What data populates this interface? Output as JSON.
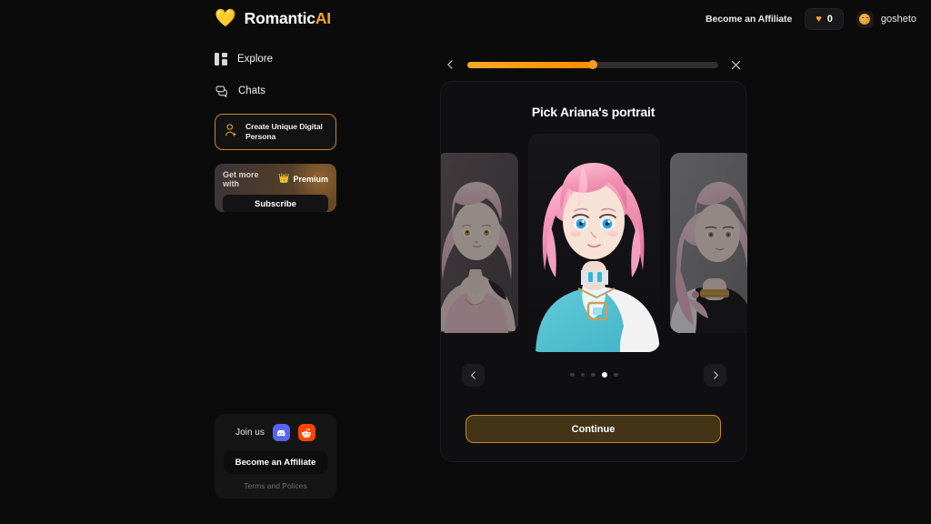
{
  "brand": {
    "heart": "💛",
    "name": "Romantic",
    "suffix": "AI"
  },
  "header": {
    "affiliate_label": "Become an Affiliate",
    "token_icon": "heart-icon",
    "token_count": "0",
    "user_name": "gosheto",
    "avatar_icon": "user-avatar-icon"
  },
  "sidebar": {
    "items": [
      {
        "label": "Explore",
        "icon": "grid-icon"
      },
      {
        "label": "Chats",
        "icon": "chat-bubble-icon"
      }
    ],
    "create_persona": {
      "label": "Create Unique Digital Persona",
      "icon": "add-user-icon"
    },
    "premium": {
      "prefix": "Get more with",
      "crown": "👑",
      "word": "Premium",
      "subscribe_label": "Subscribe"
    },
    "bottom": {
      "join_label": "Join us",
      "socials": [
        {
          "name": "discord-icon",
          "color": "#5865f2"
        },
        {
          "name": "reddit-icon",
          "color": "#ff4500"
        }
      ],
      "affiliate_button": "Become an Affiliate",
      "terms_label": "Terms and Polices"
    }
  },
  "progress": {
    "back_icon": "chevron-left-icon",
    "close_icon": "close-icon",
    "percent": 50
  },
  "modal": {
    "title": "Pick Ariana's portrait",
    "continue_label": "Continue",
    "prev_icon": "chevron-left-icon",
    "next_icon": "chevron-right-icon",
    "dots_total": 5,
    "dots_active_index": 3,
    "portraits": [
      {
        "name": "portrait-left",
        "hair": "#f0cdd4",
        "eyes": "#b99a4e",
        "outfit": "#eec9cf",
        "bg": "#595053",
        "selected": false
      },
      {
        "name": "portrait-center",
        "hair": "#f2a0bb",
        "eyes": "#2f9fe0",
        "outfit": "#4fc2d4",
        "bg": "#16161a",
        "selected": true
      },
      {
        "name": "portrait-right",
        "hair": "#f0ccd4",
        "eyes": "#9f9aa8",
        "outfit": "#1a1a1c",
        "bg": "#8c8c8e",
        "selected": false
      }
    ]
  },
  "colors": {
    "accent": "#f5a623",
    "bg": "#0b0b0c",
    "panel": "#0f0f11"
  }
}
